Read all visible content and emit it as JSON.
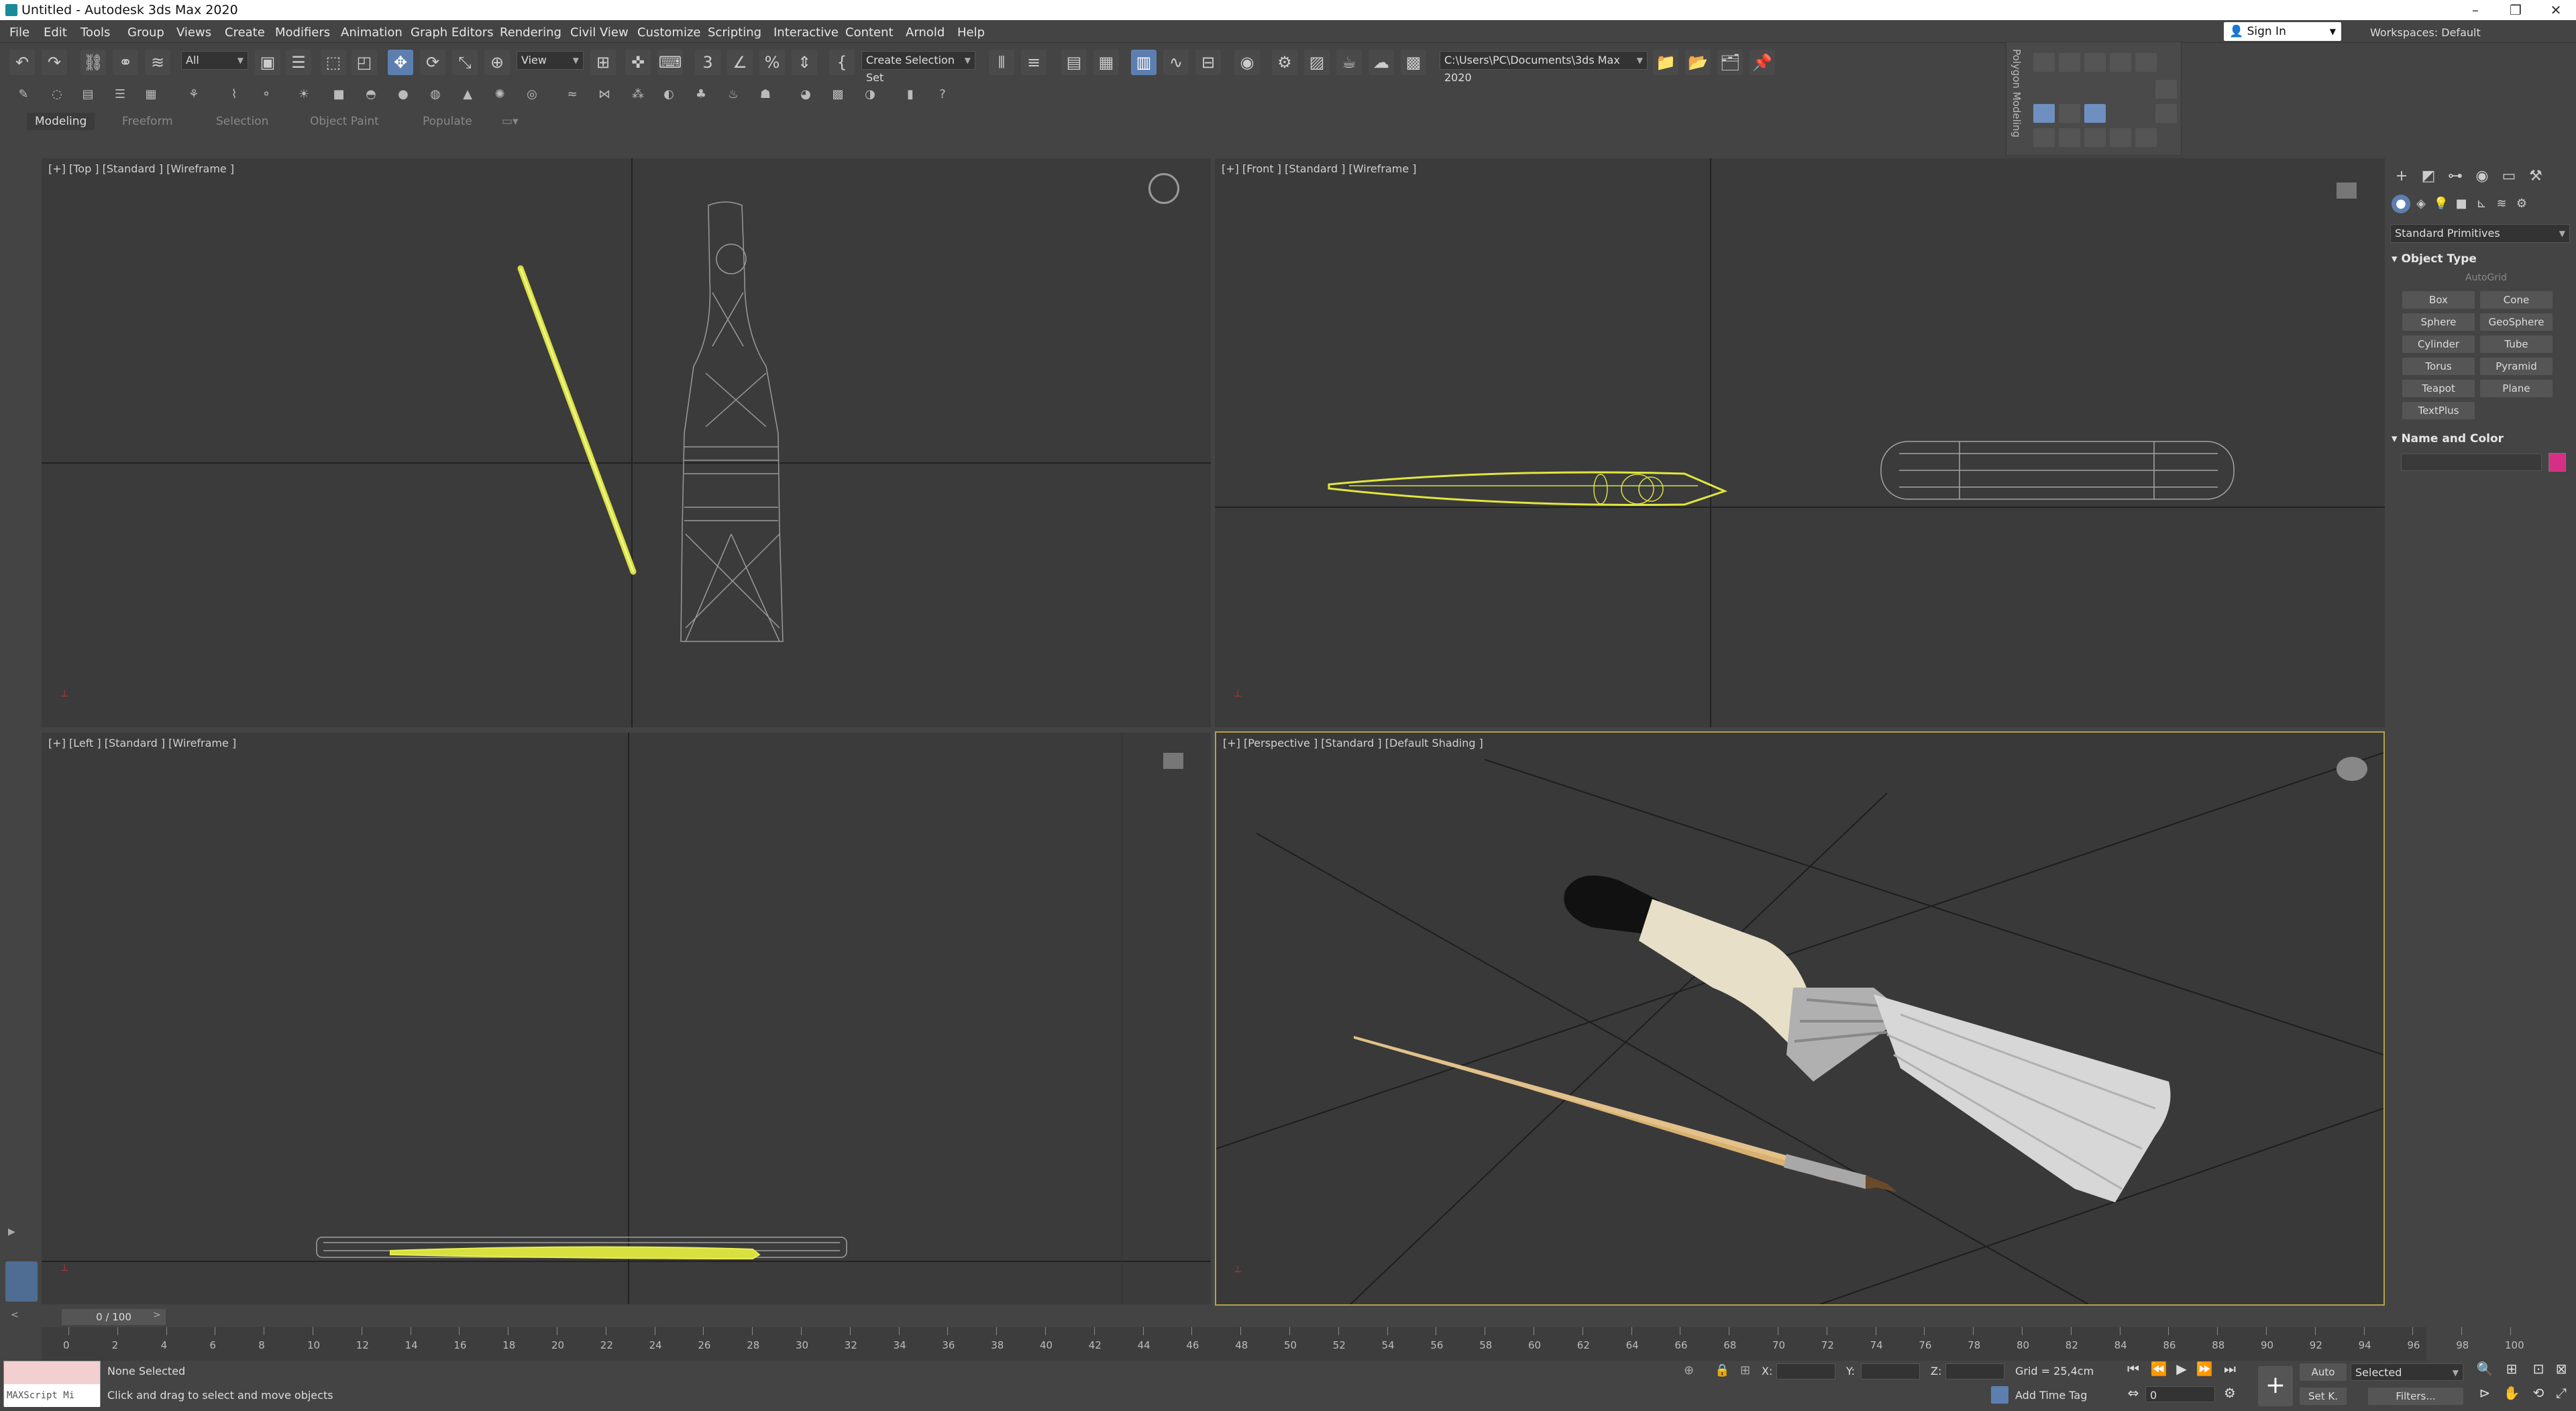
{
  "title": "Untitled - Autodesk 3ds Max 2020",
  "menu": [
    "File",
    "Edit",
    "Tools",
    "Group",
    "Views",
    "Create",
    "Modifiers",
    "Animation",
    "Graph Editors",
    "Rendering",
    "Civil View",
    "Customize",
    "Scripting",
    "Interactive",
    "Content",
    "Arnold",
    "Help"
  ],
  "signin": "Sign In",
  "workspaces": "Workspaces: Default",
  "toolbar": {
    "filter": "All",
    "refcoord": "View",
    "selset": "Create Selection Set",
    "path": "C:\\Users\\PC\\Documents\\3ds Max 2020"
  },
  "ribbon": [
    "Modeling",
    "Freeform",
    "Selection",
    "Object Paint",
    "Populate"
  ],
  "polymodeling": "Polygon Modeling",
  "viewports": {
    "top": "[+] [Top ] [Standard ] [Wireframe ]",
    "front": "[+] [Front ] [Standard ] [Wireframe ]",
    "left": "[+] [Left ] [Standard ] [Wireframe ]",
    "persp": "[+] [Perspective ] [Standard ] [Default Shading ]"
  },
  "cmd": {
    "category": "Standard Primitives",
    "object_type": "Object Type",
    "autogrid": "AutoGrid",
    "buttons": [
      "Box",
      "Cone",
      "Sphere",
      "GeoSphere",
      "Cylinder",
      "Tube",
      "Torus",
      "Pyramid",
      "Teapot",
      "Plane",
      "TextPlus"
    ],
    "name_color": "Name and Color",
    "swatch": "#d62f86"
  },
  "time": {
    "slider": "0 / 100",
    "ticks": [
      "0",
      "2",
      "4",
      "6",
      "8",
      "10",
      "12",
      "14",
      "16",
      "18",
      "20",
      "22",
      "24",
      "26",
      "28",
      "30",
      "32",
      "34",
      "36",
      "38",
      "40",
      "42",
      "44",
      "46",
      "48",
      "50",
      "52",
      "54",
      "56",
      "58",
      "60",
      "62",
      "64",
      "66",
      "68",
      "70",
      "72",
      "74",
      "76",
      "78",
      "80",
      "82",
      "84",
      "86",
      "88",
      "90",
      "92",
      "94",
      "96",
      "98",
      "100"
    ]
  },
  "status": {
    "selected": "None Selected",
    "prompt": "Click and drag to select and move objects",
    "maxscript": "MAXScript Mi",
    "x": "X:",
    "y": "Y:",
    "z": "Z:",
    "grid": "Grid = 25,4cm",
    "timetag": "Add Time Tag",
    "auto": "Auto",
    "selected_dd": "Selected",
    "setk": "Set K.",
    "filters": "Filters...",
    "frame": "0"
  }
}
